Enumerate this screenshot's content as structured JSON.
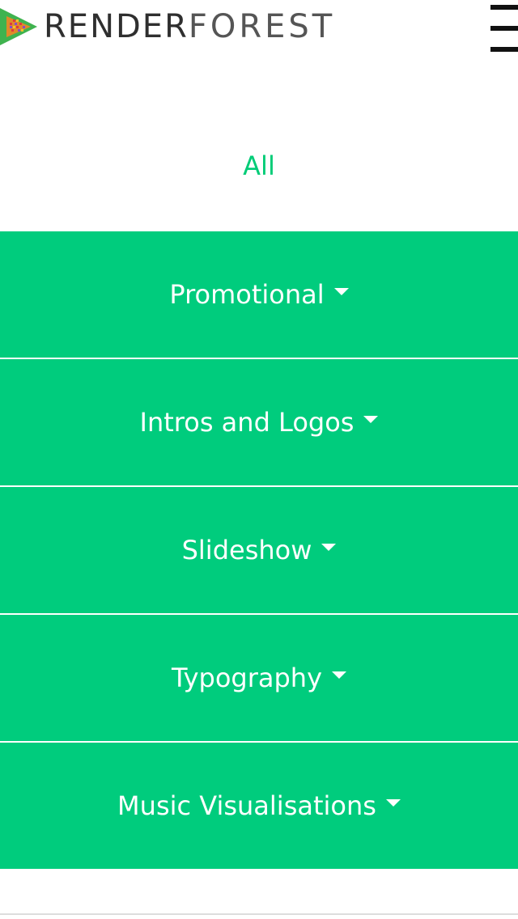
{
  "header": {
    "logo_text_bold": "RENDER",
    "logo_text_light": "FOREST",
    "menu_icon": "hamburger-menu-icon"
  },
  "filter": {
    "all_label": "All"
  },
  "categories": [
    {
      "label": "Promotional",
      "icon": "caret-down-icon"
    },
    {
      "label": "Intros and Logos",
      "icon": "caret-down-icon"
    },
    {
      "label": "Slideshow",
      "icon": "caret-down-icon"
    },
    {
      "label": "Typography",
      "icon": "caret-down-icon"
    },
    {
      "label": "Music Visualisations",
      "icon": "caret-down-icon"
    }
  ],
  "colors": {
    "accent": "#00cc7d",
    "accent_text": "#00cc77",
    "background": "#ffffff",
    "category_text": "#ffffff"
  }
}
